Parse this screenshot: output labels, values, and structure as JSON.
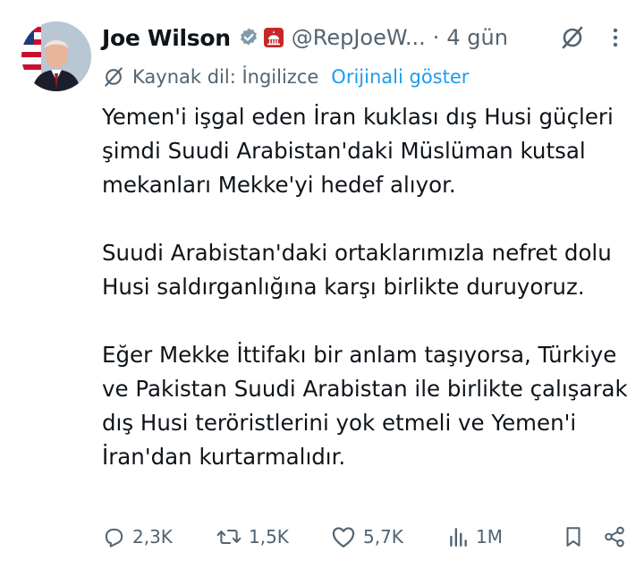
{
  "tweet": {
    "author_name": "Joe Wilson",
    "handle": "@RepJoeW...",
    "separator": "·",
    "time": "4 gün",
    "icons": {
      "verified": "verified-badge-icon",
      "government": "us-capitol-seal-icon",
      "grok": "grok-icon",
      "more": "more-dots-icon"
    },
    "colors": {
      "verified": "#829aab",
      "government_badge": "#c62828",
      "link": "#1d9bf0",
      "secondary": "#536471"
    }
  },
  "translation": {
    "source_label": "Kaynak dil: İngilizce",
    "show_original": "Orijinali göster"
  },
  "content": {
    "paragraphs": [
      "Yemen'i işgal eden İran kuklası dış Husi güçleri şimdi Suudi Arabistan'daki Müslüman kutsal mekanları Mekke'yi hedef alıyor.",
      "Suudi Arabistan'daki ortaklarımızla nefret dolu Husi saldırganlığına karşı birlikte duruyoruz.",
      "Eğer Mekke İttifakı bir anlam taşıyorsa, Türkiye ve Pakistan Suudi Arabistan ile birlikte çalışarak dış Husi teröristlerini yok etmeli ve Yemen'i İran'dan kurtarmalıdır."
    ]
  },
  "actions": {
    "replies": "2,3K",
    "reposts": "1,5K",
    "likes": "5,7K",
    "views": "1M",
    "icons": [
      "reply-icon",
      "repost-icon",
      "like-icon",
      "views-icon",
      "bookmark-icon",
      "share-icon"
    ]
  }
}
